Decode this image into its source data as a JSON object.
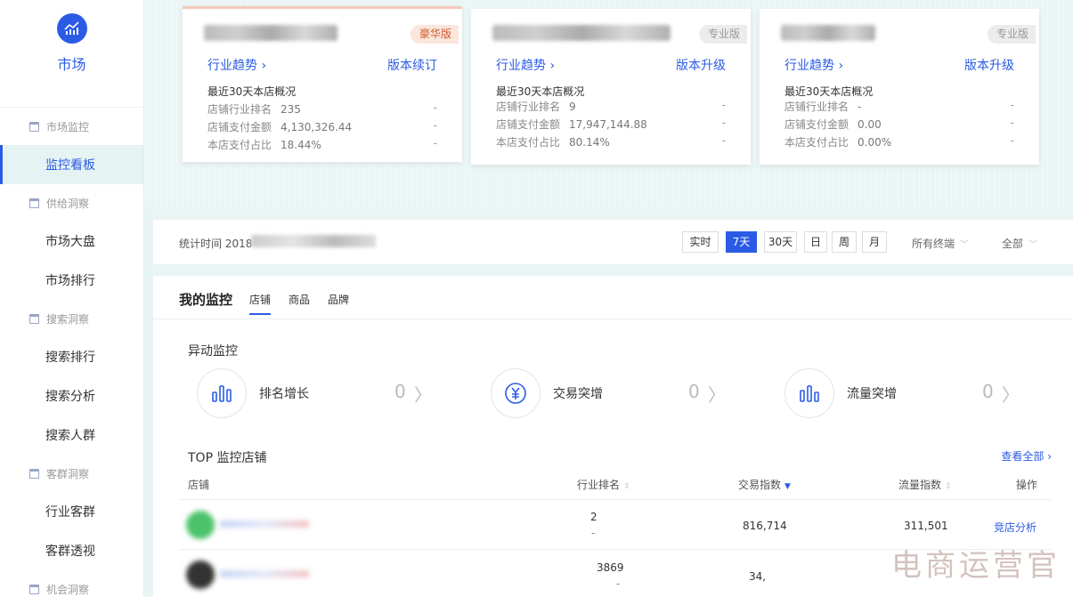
{
  "sidebar": {
    "logo_label": "市场",
    "items": [
      {
        "type": "group",
        "label": "市场监控"
      },
      {
        "type": "item",
        "label": "监控看板",
        "active": true
      },
      {
        "type": "group",
        "label": "供给洞察"
      },
      {
        "type": "item",
        "label": "市场大盘"
      },
      {
        "type": "item",
        "label": "市场排行"
      },
      {
        "type": "group",
        "label": "搜索洞察"
      },
      {
        "type": "item",
        "label": "搜索排行"
      },
      {
        "type": "item",
        "label": "搜索分析"
      },
      {
        "type": "item",
        "label": "搜索人群"
      },
      {
        "type": "group",
        "label": "客群洞察"
      },
      {
        "type": "item",
        "label": "行业客群"
      },
      {
        "type": "item",
        "label": "客群透视"
      },
      {
        "type": "group",
        "label": "机会洞察"
      }
    ]
  },
  "cards": [
    {
      "badge": "豪华版",
      "badge_type": "lux",
      "trend_label": "行业趋势 ›",
      "version_label": "版本续订",
      "overview_title": "最近30天本店概况",
      "rows": [
        {
          "label": "店铺行业排名",
          "value": "235",
          "dash": "-"
        },
        {
          "label": "店铺支付金额",
          "value": "4,130,326.44",
          "dash": "-"
        },
        {
          "label": "本店支付占比",
          "value": "18.44%",
          "dash": "-"
        }
      ]
    },
    {
      "badge": "专业版",
      "badge_type": "pro",
      "trend_label": "行业趋势 ›",
      "version_label": "版本升级",
      "overview_title": "最近30天本店概况",
      "rows": [
        {
          "label": "店铺行业排名",
          "value": "9",
          "dash": "-"
        },
        {
          "label": "店铺支付金额",
          "value": "17,947,144.88",
          "dash": "-"
        },
        {
          "label": "本店支付占比",
          "value": "80.14%",
          "dash": "-"
        }
      ]
    },
    {
      "badge": "专业版",
      "badge_type": "pro",
      "trend_label": "行业趋势 ›",
      "version_label": "版本升级",
      "overview_title": "最近30天本店概况",
      "rows": [
        {
          "label": "店铺行业排名",
          "value": "-",
          "dash": "-"
        },
        {
          "label": "店铺支付金额",
          "value": "0.00",
          "dash": "-"
        },
        {
          "label": "本店支付占比",
          "value": "0.00%",
          "dash": "-"
        }
      ]
    }
  ],
  "filter": {
    "stat_time_label": "统计时间 2018",
    "time_buttons": [
      "实时",
      "7天",
      "30天",
      "日",
      "周",
      "月"
    ],
    "active_time": "7天",
    "terminal": "所有终端",
    "all": "全部"
  },
  "monitor": {
    "title": "我的监控",
    "tabs": [
      "店铺",
      "商品",
      "品牌"
    ],
    "active_tab": "店铺",
    "anomaly_title": "异动监控",
    "anomalies": [
      {
        "label": "排名增长",
        "count": "0",
        "icon": "bar-chart-icon"
      },
      {
        "label": "交易突增",
        "count": "0",
        "icon": "yen-icon"
      },
      {
        "label": "流量突增",
        "count": "0",
        "icon": "bar-chart-icon"
      }
    ],
    "top_title": "TOP 监控店铺",
    "view_all": "查看全部 ›",
    "columns": [
      "店铺",
      "行业排名",
      "交易指数",
      "流量指数",
      "操作"
    ],
    "rows": [
      {
        "rank": "2",
        "rank_sub": "-",
        "trade": "816,714",
        "traffic": "311,501",
        "action": "竞店分析"
      },
      {
        "rank": "3869",
        "rank_sub": "-",
        "trade": "34,",
        "traffic": "",
        "action": ""
      }
    ]
  },
  "watermark": "电商运营官",
  "colors": {
    "accent": "#2b5be5",
    "lux_badge_text": "#d25a2a",
    "background": "#e9f4f4"
  }
}
